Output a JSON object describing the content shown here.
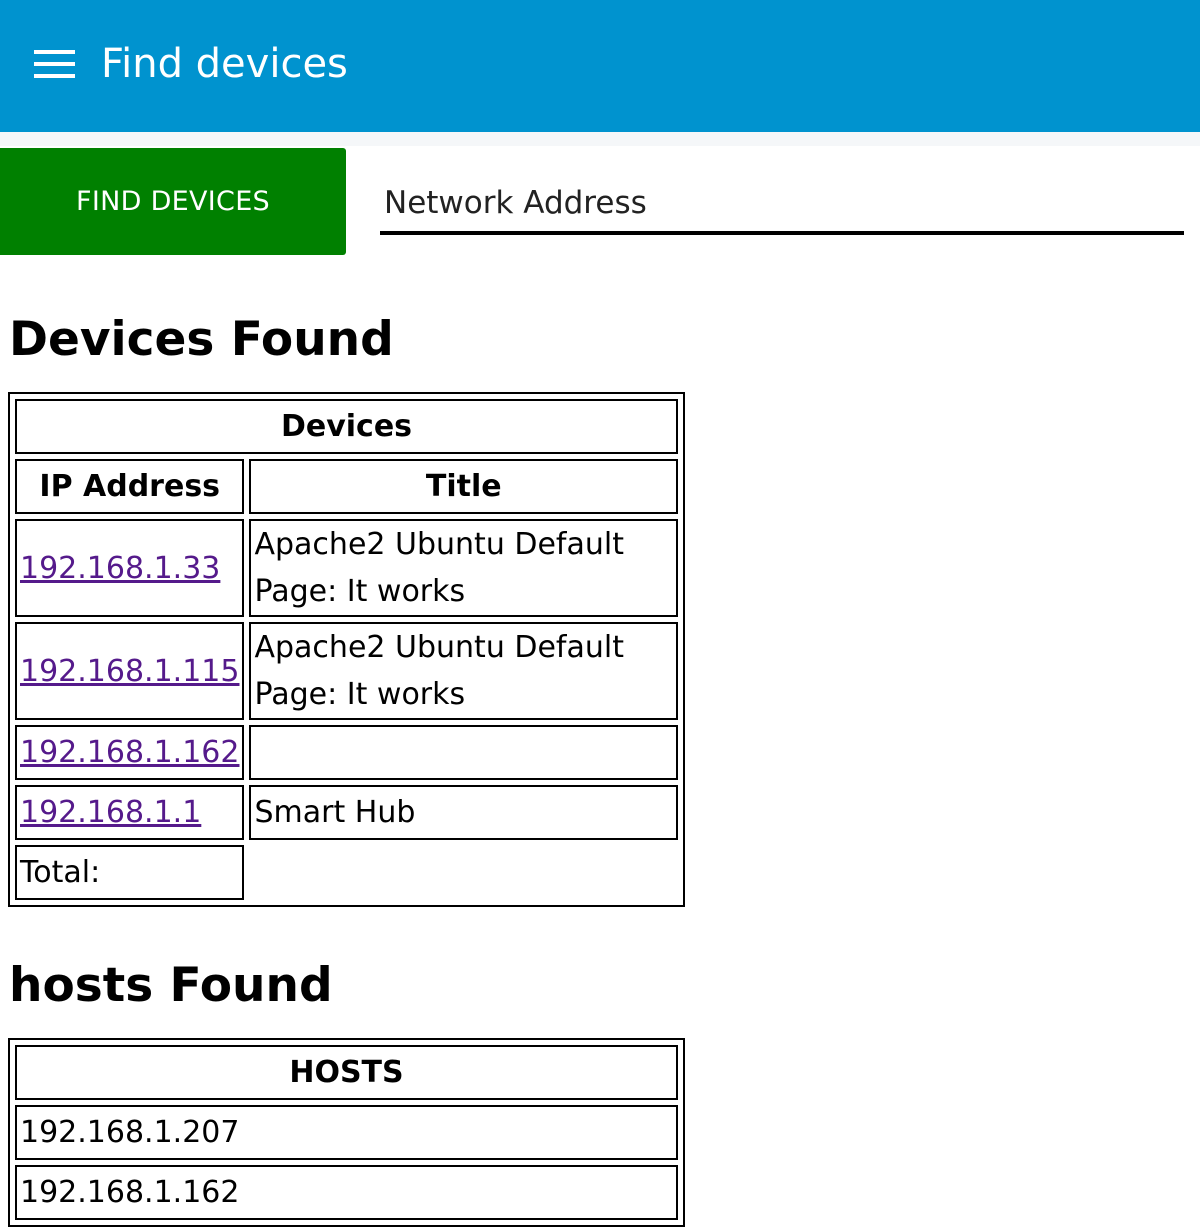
{
  "appbar": {
    "title": "Find devices",
    "menu_icon": "hamburger-menu-icon",
    "color": "#0093cf"
  },
  "toolbar": {
    "find_button_label": "FIND DEVICES",
    "find_button_color": "#008000",
    "network_address_placeholder": "Network Address",
    "network_address_value": ""
  },
  "devices": {
    "heading": "Devices Found",
    "table_caption": "Devices",
    "columns": [
      "IP Address",
      "Title"
    ],
    "rows": [
      {
        "ip": "192.168.1.33",
        "title": "Apache2 Ubuntu Default Page: It works"
      },
      {
        "ip": "192.168.1.115",
        "title": "Apache2 Ubuntu Default Page: It works"
      },
      {
        "ip": "192.168.1.162",
        "title": ""
      },
      {
        "ip": "192.168.1.1",
        "title": "Smart Hub"
      }
    ],
    "total_label": "Total:"
  },
  "hosts": {
    "heading": "hosts Found",
    "table_caption": "HOSTS",
    "rows": [
      "192.168.1.207",
      "192.168.1.162"
    ]
  }
}
